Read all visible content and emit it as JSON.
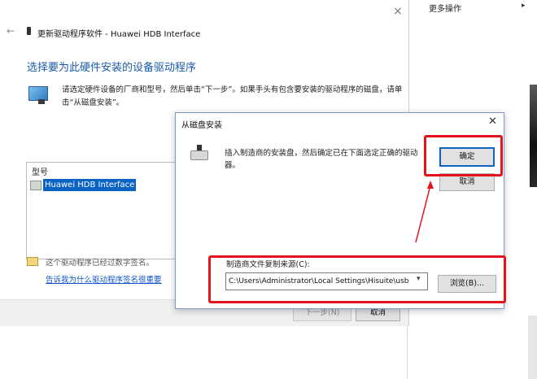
{
  "window": {
    "title": "更新驱动程序软件 - Huawei HDB Interface",
    "heading": "选择要为此硬件安装的设备驱动程序",
    "instruction": "请选定硬件设备的厂商和型号，然后单击“下一步”。如果手头有包含要安装的驱动程序的磁盘，请单击“从磁盘安装”。",
    "close_glyph": "×",
    "back_glyph": "←"
  },
  "model_list": {
    "header": "型号",
    "items": [
      {
        "label": "Huawei HDB Interface",
        "selected": true
      }
    ]
  },
  "signature": {
    "status_text": "这个驱动程序已经过数字签名。",
    "link_text": "告诉我为什么驱动程序签名很重要"
  },
  "footer": {
    "next_label": "下一步(N)",
    "cancel_label": "取消"
  },
  "disk_dialog": {
    "title": "从磁盘安装",
    "close_glyph": "✕",
    "message": "插入制造商的安装盘，然后确定已在下面选定正确的驱动器。",
    "ok_label": "确定",
    "cancel_label": "取消",
    "path_label": "制造商文件复制来源(C):",
    "path_value": "C:\\Users\\Administrator\\Local Settings\\Hisuite\\usb",
    "browse_label": "浏览(B)..."
  },
  "background_pane": {
    "actions_label": "更多操作",
    "actions_arrow": "▸"
  },
  "colors": {
    "heading": "#1c5aa6",
    "selection": "#0a64c4",
    "annotation": "#e3141c"
  }
}
